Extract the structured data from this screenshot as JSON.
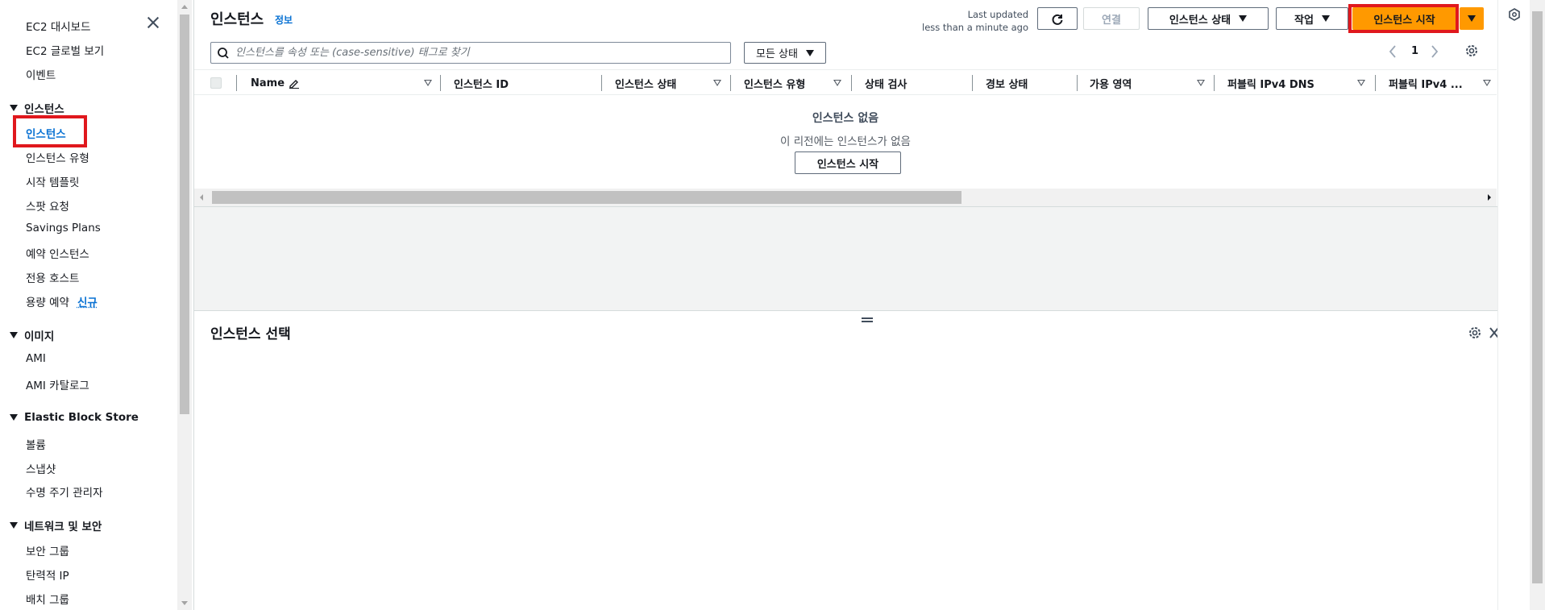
{
  "sidebar": {
    "top_items": [
      "EC2 대시보드",
      "EC2 글로벌 보기",
      "이벤트"
    ],
    "sections": [
      {
        "title": "인스턴스",
        "items": [
          "인스턴스",
          "인스턴스 유형",
          "시작 템플릿",
          "스팟 요청",
          "Savings Plans",
          "예약 인스턴스",
          "전용 호스트",
          "용량 예약"
        ]
      },
      {
        "title": "이미지",
        "items": [
          "AMI",
          "AMI 카탈로그"
        ]
      },
      {
        "title": "Elastic Block Store",
        "items": [
          "볼륨",
          "스냅샷",
          "수명 주기 관리자"
        ]
      },
      {
        "title": "네트워크 및 보안",
        "items": [
          "보안 그룹",
          "탄력적 IP",
          "배치 그룹"
        ]
      }
    ],
    "new_badge": "신규",
    "active_item": "인스턴스"
  },
  "header": {
    "title": "인스턴스",
    "info": "정보",
    "last_updated_1": "Last updated",
    "last_updated_2": "less than a minute ago",
    "connect": "연결",
    "instance_state": "인스턴스 상태",
    "actions": "작업",
    "launch": "인스턴스 시작"
  },
  "search": {
    "placeholder": "인스턴스를 속성 또는 (case-sensitive) 태그로 찾기",
    "state_filter": "모든 상태"
  },
  "pagination": {
    "page": "1"
  },
  "table": {
    "columns": [
      "Name",
      "인스턴스 ID",
      "인스턴스 상태",
      "인스턴스 유형",
      "상태 검사",
      "경보 상태",
      "가용 영역",
      "퍼블릭 IPv4 DNS",
      "퍼블릭 IPv4 ..."
    ],
    "empty_title": "인스턴스 없음",
    "empty_desc": "이 리전에는 인스턴스가 없음",
    "empty_button": "인스턴스 시작"
  },
  "split_panel": {
    "title": "인스턴스 선택"
  },
  "colors": {
    "accent": "#0972d3",
    "primary_button": "#ff9900",
    "highlight": "#e0181d"
  }
}
